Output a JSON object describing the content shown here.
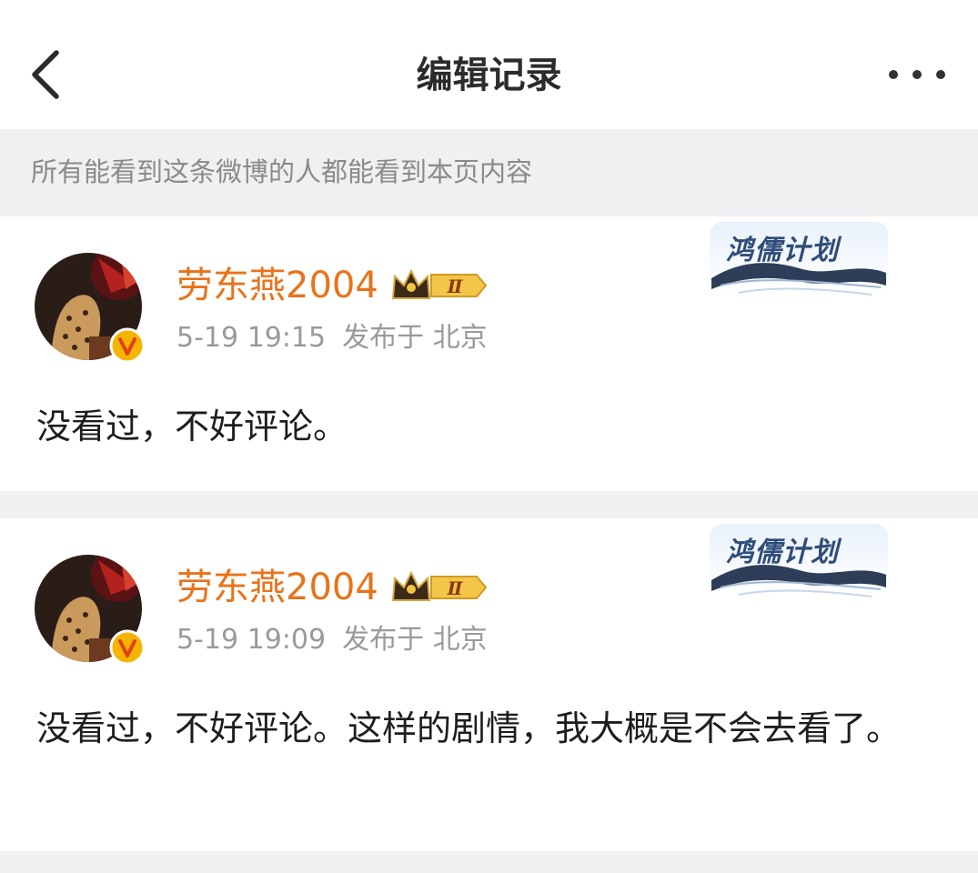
{
  "header": {
    "title": "编辑记录",
    "back_icon": "chevron-left-icon",
    "more_icon": "more-dots-icon"
  },
  "notice": {
    "text": "所有能看到这条微博的人都能看到本页内容"
  },
  "posts": [
    {
      "username": "劳东燕2004",
      "time": "5-19 19:15",
      "location": "发布于 北京",
      "badge_text": "鸿儒计划",
      "crown_level": "Ⅱ",
      "content": "没看过，不好评论。"
    },
    {
      "username": "劳东燕2004",
      "time": "5-19 19:09",
      "location": "发布于 北京",
      "badge_text": "鸿儒计划",
      "crown_level": "Ⅱ",
      "content": "没看过，不好评论。这样的剧情，我大概是不会去看了。"
    }
  ],
  "colors": {
    "username": "#e8731a",
    "verified_badge": "#f5b400",
    "notice_bg": "#f0f0f2"
  }
}
